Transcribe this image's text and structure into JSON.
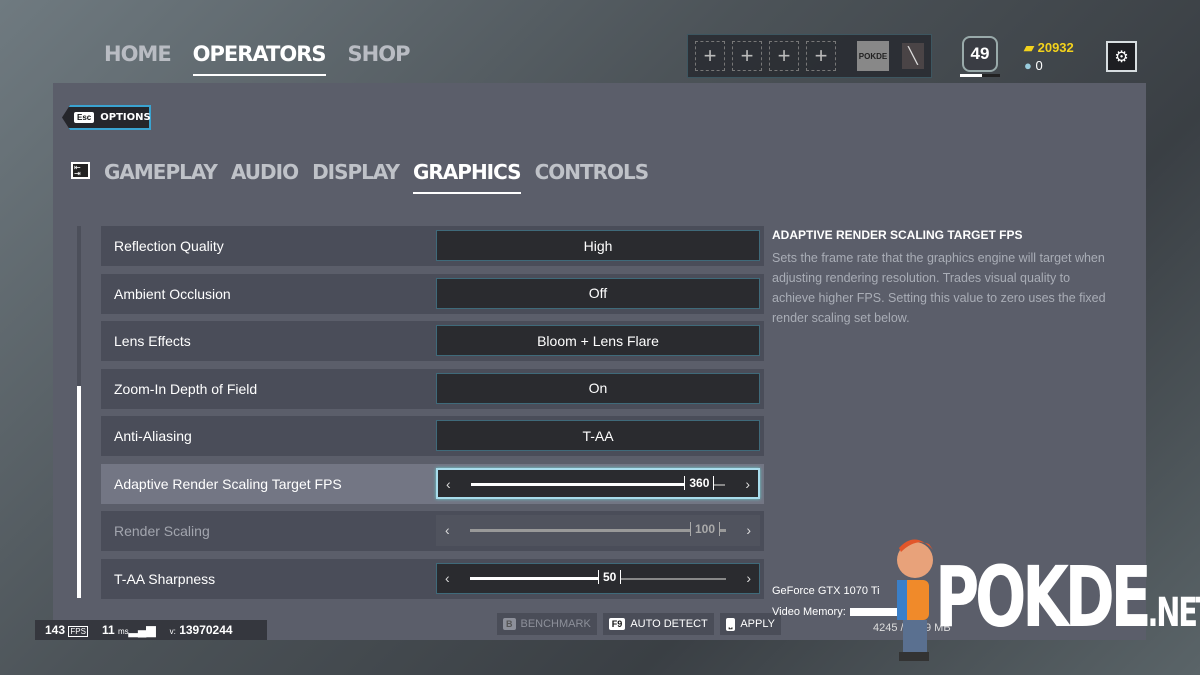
{
  "topnav": {
    "items": [
      {
        "label": "HOME",
        "active": false
      },
      {
        "label": "OPERATORS",
        "active": true
      },
      {
        "label": "SHOP",
        "active": false
      }
    ]
  },
  "squad": {
    "slots": [
      "+",
      "+",
      "+",
      "+"
    ],
    "charm": "POKDE"
  },
  "player": {
    "level": "49",
    "level_progress": 0.55,
    "renown": "20932",
    "credits": "0"
  },
  "options": {
    "esc_key": "Esc",
    "label": "OPTIONS"
  },
  "tabs": [
    {
      "label": "GAMEPLAY",
      "active": false
    },
    {
      "label": "AUDIO",
      "active": false
    },
    {
      "label": "DISPLAY",
      "active": false
    },
    {
      "label": "GRAPHICS",
      "active": true
    },
    {
      "label": "CONTROLS",
      "active": false
    }
  ],
  "settings": [
    {
      "label": "Reflection Quality",
      "value": "High"
    },
    {
      "label": "Ambient Occlusion",
      "value": "Off"
    },
    {
      "label": "Lens Effects",
      "value": "Bloom + Lens Flare"
    },
    {
      "label": "Zoom-In Depth of Field",
      "value": "On"
    },
    {
      "label": "Anti-Aliasing",
      "value": "T-AA"
    },
    {
      "label": "Adaptive Render Scaling Target FPS",
      "slider": "360",
      "fraction": 0.84,
      "highlighted": true
    },
    {
      "label": "Render Scaling",
      "slider": "100",
      "fraction": 1.0,
      "disabled": true
    },
    {
      "label": "T-AA Sharpness",
      "slider": "50",
      "fraction": 0.5
    }
  ],
  "description": {
    "title": "ADAPTIVE RENDER SCALING TARGET FPS",
    "text": "Sets the frame rate that the graphics engine will target when adjusting rendering resolution. Trades visual quality to achieve higher FPS. Setting this value to zero uses the fixed render scaling set below."
  },
  "buttons": [
    {
      "key": "B",
      "label": "BENCHMARK",
      "disabled": true
    },
    {
      "key": "F9",
      "label": "AUTO DETECT"
    },
    {
      "key": "⎵",
      "label": "APPLY"
    }
  ],
  "gpu": {
    "name": "GeForce GTX 1070 Ti",
    "vmem_label": "Video Memory:",
    "vmem_value": "4245 / 8079 MB"
  },
  "stats": {
    "fps": "143",
    "fps_unit": "FPS",
    "ms": "11",
    "ms_unit": "ms",
    "version_label": "v:",
    "version": "13970244"
  },
  "watermark": {
    "text": "POKDE",
    "suffix": ".NET"
  },
  "colors": {
    "accent": "#3aa3d0",
    "renown": "#f3d21c",
    "panel": "#5b5e6a"
  }
}
